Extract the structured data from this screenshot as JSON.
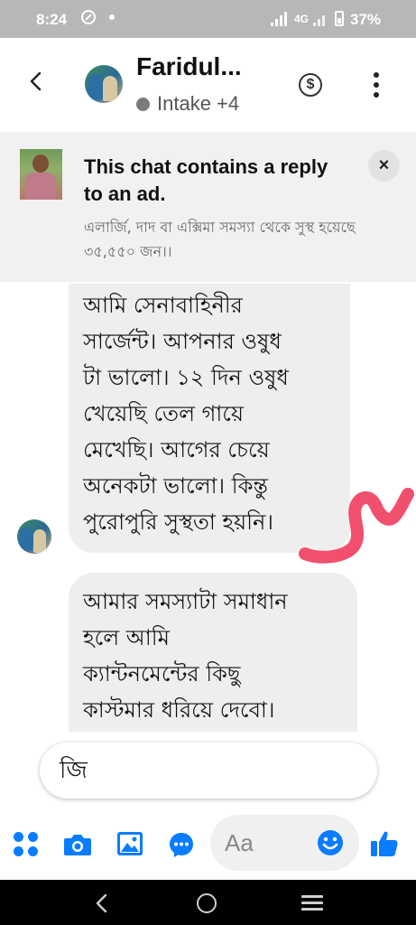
{
  "status_bar": {
    "time": "8:24",
    "network": "4G",
    "battery": "37%"
  },
  "header": {
    "contact_name": "Faridul...",
    "status_text": "Intake +4",
    "icons": [
      "back-arrow-icon",
      "contact-avatar",
      "dollar-icon",
      "more-vertical-icon"
    ]
  },
  "ad_banner": {
    "title": "This chat contains a reply to an ad.",
    "subtitle": "এলার্জি, দাদ বা এক্সিমা সমস্যা থেকে সুস্থ হয়েছে ৩৫,৫৫০ জন।।",
    "close_label": "×"
  },
  "messages": [
    {
      "sender": "incoming",
      "text": "আমি সেনাবাহিনীর\nসার্জেন্ট। আপনার ওষুধ\nটা ভালো। ১২ দিন ওষুধ\nখেয়েছি তেল গায়ে\nমেখেছি। আগের চেয়ে\nঅনেকটা ভালো। কিন্তু\nপুরোপুরি সুস্থতা হয়নি।"
    },
    {
      "sender": "incoming",
      "text": "আমার সমস্যাটা সমাধান\nহলে আমি\nক্যান্টনমেন্টের কিছু\nকাস্টমার ধরিয়ে দেবো।"
    }
  ],
  "quick_reply": "জি",
  "composer": {
    "placeholder": "Aa",
    "accent_color": "#0a7cff"
  },
  "annotation_color": "#f0506e"
}
